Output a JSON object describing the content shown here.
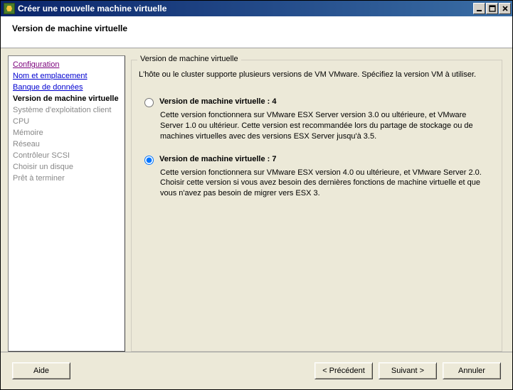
{
  "titlebar": {
    "title": "Créer une nouvelle machine virtuelle"
  },
  "header": {
    "title": "Version de machine virtuelle"
  },
  "sidebar": {
    "items": [
      {
        "label": "Configuration",
        "state": "visited"
      },
      {
        "label": "Nom et emplacement",
        "state": "link"
      },
      {
        "label": "Banque de données",
        "state": "link"
      },
      {
        "label": "Version de machine virtuelle",
        "state": "active"
      },
      {
        "label": "Système d'exploitation client",
        "state": "disabled"
      },
      {
        "label": "CPU",
        "state": "disabled"
      },
      {
        "label": "Mémoire",
        "state": "disabled"
      },
      {
        "label": "Réseau",
        "state": "disabled"
      },
      {
        "label": "Contrôleur SCSI",
        "state": "disabled"
      },
      {
        "label": "Choisir un disque",
        "state": "disabled"
      },
      {
        "label": "Prêt à terminer",
        "state": "disabled"
      }
    ]
  },
  "main": {
    "legend": "Version de machine virtuelle",
    "intro": "L'hôte ou le cluster supporte plusieurs versions de VM VMware. Spécifiez la version VM à utiliser.",
    "options": [
      {
        "label": "Version de machine virtuelle : 4",
        "desc": "Cette version fonctionnera sur VMware ESX Server version 3.0 ou ultérieure, et VMware Server 1.0 ou ultérieur. Cette version est recommandée lors du partage de stockage ou de machines virtuelles avec des versions ESX Server jusqu'à 3.5.",
        "selected": false
      },
      {
        "label": "Version de machine virtuelle : 7",
        "desc": "Cette version fonctionnera sur VMware ESX version 4.0 ou ultérieure, et  VMware Server 2.0. Choisir cette version si vous avez besoin des dernières fonctions de machine virtuelle et que vous n'avez pas besoin de migrer vers  ESX 3.",
        "selected": true
      }
    ]
  },
  "footer": {
    "help": "Aide",
    "back": "< Précédent",
    "next": "Suivant >",
    "cancel": "Annuler"
  }
}
